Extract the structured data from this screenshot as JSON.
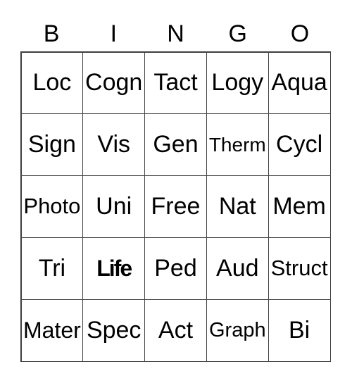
{
  "header": [
    "B",
    "I",
    "N",
    "G",
    "O"
  ],
  "cells": [
    [
      "Loc",
      "Cogn",
      "Tact",
      "Logy",
      "Aqua"
    ],
    [
      "Sign",
      "Vis",
      "Gen",
      "Therm",
      "Cycl"
    ],
    [
      "Photo",
      "Uni",
      "Free",
      "Nat",
      "Mem"
    ],
    [
      "Tri",
      "Life",
      "Ped",
      "Aud",
      "Struct"
    ],
    [
      "Mater",
      "Spec",
      "Act",
      "Graph",
      "Bi"
    ]
  ],
  "free_space": {
    "row": 3,
    "col": 1
  }
}
